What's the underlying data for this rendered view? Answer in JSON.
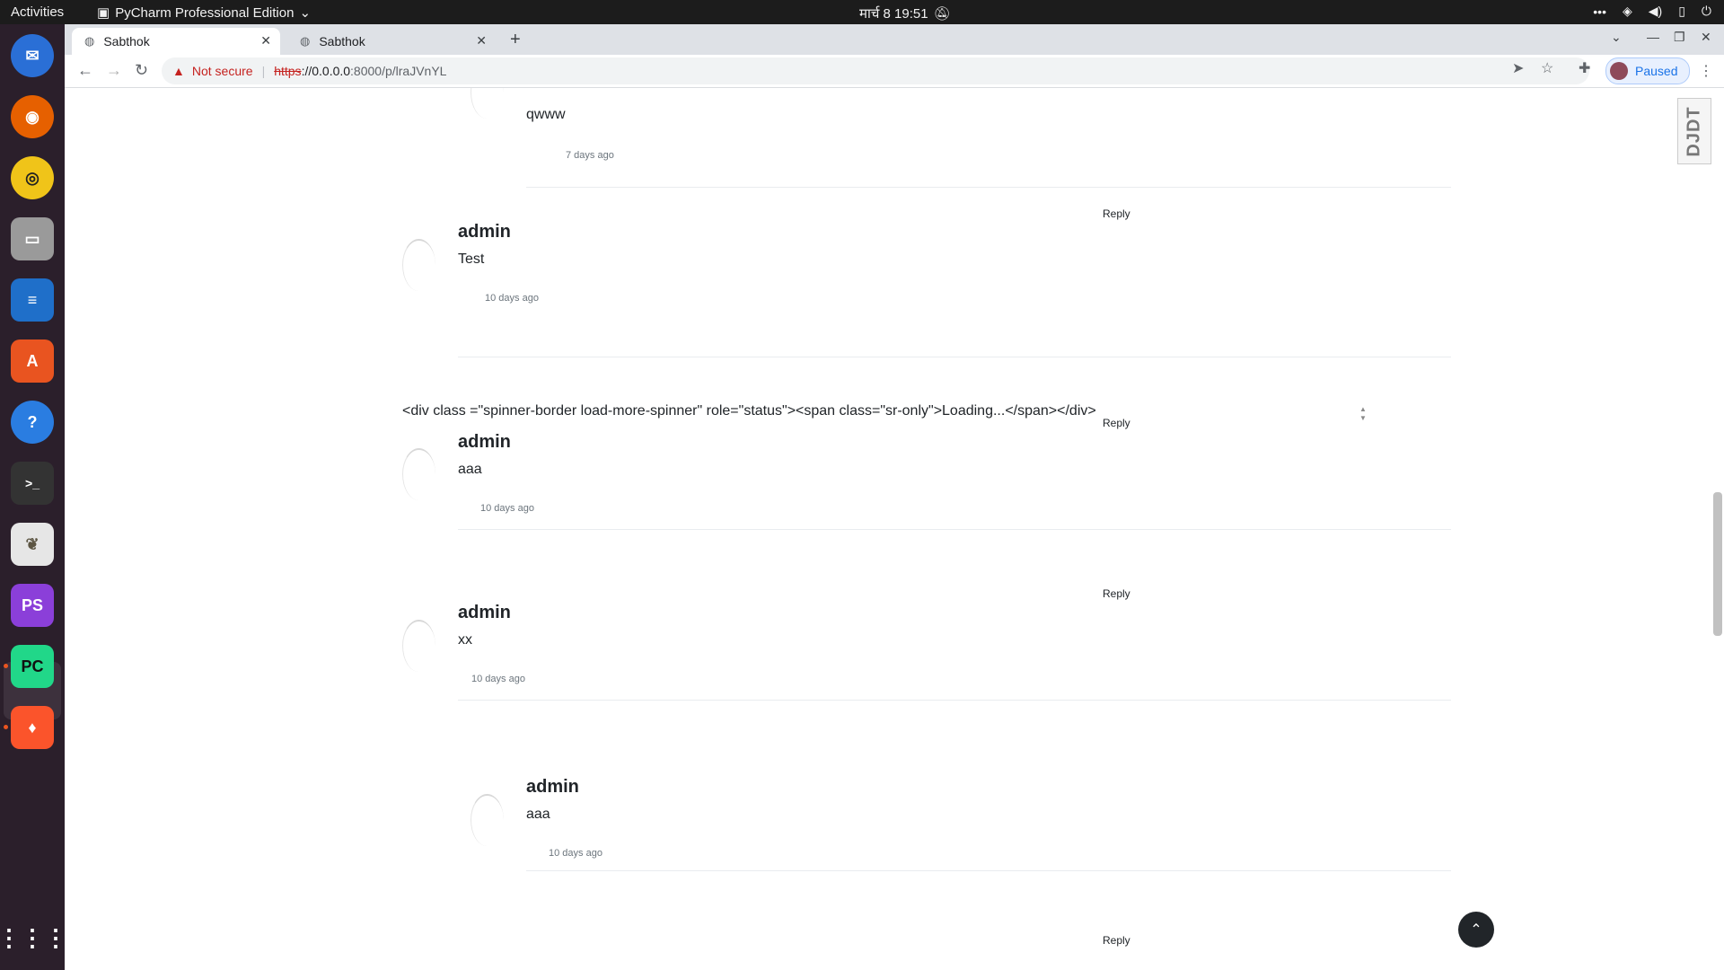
{
  "topbar": {
    "activities": "Activities",
    "app_menu": "PyCharm Professional Edition",
    "clock": "मार्च 8  19:51"
  },
  "dock": {
    "items": [
      {
        "name": "thunderbird-icon",
        "color": "#2a6fd6"
      },
      {
        "name": "firefox-icon",
        "color": "#e66000"
      },
      {
        "name": "rhythmbox-icon",
        "color": "#f0c419"
      },
      {
        "name": "files-icon",
        "color": "#8a8a8a"
      },
      {
        "name": "writer-icon",
        "color": "#1f6fc9"
      },
      {
        "name": "app-center-icon",
        "color": "#e95420"
      },
      {
        "name": "help-icon",
        "color": "#2a7de1"
      },
      {
        "name": "terminal-icon",
        "color": "#333333"
      },
      {
        "name": "gimp-icon",
        "color": "#5c5543"
      },
      {
        "name": "phpstorm-icon",
        "color": "#8b3fd9"
      },
      {
        "name": "pycharm-icon",
        "color": "#21d789"
      },
      {
        "name": "brave-icon",
        "color": "#fb542b"
      },
      {
        "name": "show-apps-icon",
        "color": "#ffffff"
      }
    ],
    "labels": {
      "phpstorm": "PS",
      "pycharm": "PC",
      "terminal": ">_"
    }
  },
  "browser": {
    "tabs": [
      {
        "title": "Sabthok",
        "active": true
      },
      {
        "title": "Sabthok",
        "active": false
      }
    ],
    "address": {
      "not_secure": "Not secure",
      "scheme": "https",
      "host": "://0.0.0.0",
      "path": ":8000/p/lraJVnYL"
    },
    "profile_status": "Paused"
  },
  "page": {
    "djdt_label": "DJDT",
    "raw_text": "<div class =\"spinner-border load-more-spinner\" role=\"status\"><span class=\"sr-only\">Loading...</span></div>",
    "comments": [
      {
        "author": "",
        "text": "qwww",
        "time": "7 days ago"
      },
      {
        "author": "admin",
        "text": "Test",
        "time": "10 days ago",
        "reply": "Reply"
      },
      {
        "author": "admin",
        "text": "aaa",
        "time": "10 days ago",
        "reply": "Reply"
      },
      {
        "author": "admin",
        "text": "xx",
        "time": "10 days ago",
        "reply": "Reply"
      },
      {
        "author": "admin",
        "text": "aaa",
        "time": "10 days ago"
      }
    ],
    "last_reply": "Reply"
  }
}
